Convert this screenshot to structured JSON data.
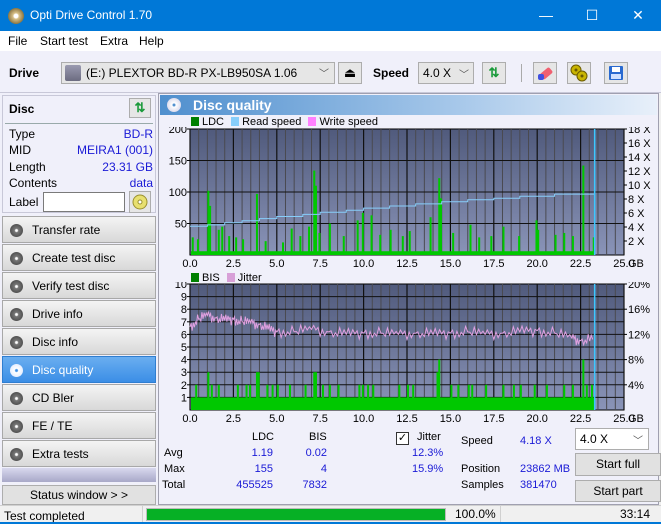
{
  "window": {
    "title": "Opti Drive Control 1.70",
    "minimize": "—",
    "maximize": "☐",
    "close": "✕"
  },
  "menu": [
    "File",
    "Start test",
    "Extra",
    "Help"
  ],
  "toolbar": {
    "drive_label": "Drive",
    "drive_value": "(E:)  PLEXTOR BD-R  PX-LB950SA 1.06",
    "eject_icon": "⏏",
    "speed_label": "Speed",
    "speed_value": "4.0 X",
    "chevron": "﹀",
    "refresh_icon": "⇅",
    "erase_icon": "eraser",
    "settings_icon": "gears",
    "save_icon": "floppy"
  },
  "disc": {
    "header": "Disc",
    "fields": [
      {
        "key": "Type",
        "value": "BD-R"
      },
      {
        "key": "MID",
        "value": "MEIRA1 (001)"
      },
      {
        "key": "Length",
        "value": "23.31 GB"
      },
      {
        "key": "Contents",
        "value": "data"
      }
    ],
    "label_key": "Label",
    "label_value": ""
  },
  "nav": [
    {
      "label": "Transfer rate",
      "active": false
    },
    {
      "label": "Create test disc",
      "active": false
    },
    {
      "label": "Verify test disc",
      "active": false
    },
    {
      "label": "Drive info",
      "active": false
    },
    {
      "label": "Disc info",
      "active": false
    },
    {
      "label": "Disc quality",
      "active": true
    },
    {
      "label": "CD Bler",
      "active": false
    },
    {
      "label": "FE / TE",
      "active": false
    },
    {
      "label": "Extra tests",
      "active": false
    }
  ],
  "status_window_button": "Status window > >",
  "main": {
    "title": "Disc quality",
    "legend_top": [
      {
        "label": "LDC",
        "color": "#008000"
      },
      {
        "label": "Read speed",
        "color": "#87cefa"
      },
      {
        "label": "Write speed",
        "color": "#ff80ff"
      }
    ],
    "legend_bottom": [
      {
        "label": "BIS",
        "color": "#008000"
      },
      {
        "label": "Jitter",
        "color": "#d8a0d8"
      }
    ]
  },
  "chart_data": [
    {
      "type": "bar",
      "title": "LDC / Read speed",
      "xlabel": "GB",
      "x_ticks": [
        "0.0",
        "2.5",
        "5.0",
        "7.5",
        "10.0",
        "12.5",
        "15.0",
        "17.5",
        "20.0",
        "22.5",
        "25.0"
      ],
      "xlim": [
        0,
        25
      ],
      "ylim_left": [
        0,
        200
      ],
      "y_ticks_left": [
        "200",
        "150",
        "100",
        "50"
      ],
      "ylim_right": [
        0,
        18
      ],
      "y_ticks_right": [
        "18 X",
        "16 X",
        "14 X",
        "12 X",
        "10 X",
        "8 X",
        "6 X",
        "4 X",
        "2 X"
      ],
      "end_marker_gb": 23.31,
      "ldc_peaks": [
        {
          "x": 0.1,
          "y": 28
        },
        {
          "x": 0.4,
          "y": 25
        },
        {
          "x": 1.0,
          "y": 102
        },
        {
          "x": 1.1,
          "y": 78
        },
        {
          "x": 1.6,
          "y": 40
        },
        {
          "x": 1.8,
          "y": 45
        },
        {
          "x": 2.2,
          "y": 30
        },
        {
          "x": 2.6,
          "y": 28
        },
        {
          "x": 3.0,
          "y": 25
        },
        {
          "x": 3.8,
          "y": 97
        },
        {
          "x": 4.3,
          "y": 22
        },
        {
          "x": 5.3,
          "y": 20
        },
        {
          "x": 5.8,
          "y": 42
        },
        {
          "x": 6.3,
          "y": 30
        },
        {
          "x": 6.8,
          "y": 45
        },
        {
          "x": 7.1,
          "y": 134
        },
        {
          "x": 7.2,
          "y": 110
        },
        {
          "x": 7.4,
          "y": 35
        },
        {
          "x": 8.0,
          "y": 50
        },
        {
          "x": 8.8,
          "y": 30
        },
        {
          "x": 9.6,
          "y": 55
        },
        {
          "x": 9.9,
          "y": 67
        },
        {
          "x": 10.4,
          "y": 63
        },
        {
          "x": 10.9,
          "y": 32
        },
        {
          "x": 11.5,
          "y": 40
        },
        {
          "x": 12.2,
          "y": 30
        },
        {
          "x": 12.6,
          "y": 38
        },
        {
          "x": 13.8,
          "y": 60
        },
        {
          "x": 14.3,
          "y": 122
        },
        {
          "x": 14.4,
          "y": 90
        },
        {
          "x": 15.1,
          "y": 35
        },
        {
          "x": 16.1,
          "y": 48
        },
        {
          "x": 16.6,
          "y": 28
        },
        {
          "x": 17.3,
          "y": 30
        },
        {
          "x": 18.0,
          "y": 45
        },
        {
          "x": 18.9,
          "y": 30
        },
        {
          "x": 19.9,
          "y": 55
        },
        {
          "x": 20.0,
          "y": 40
        },
        {
          "x": 21.0,
          "y": 32
        },
        {
          "x": 21.5,
          "y": 35
        },
        {
          "x": 22.0,
          "y": 30
        },
        {
          "x": 22.6,
          "y": 142
        },
        {
          "x": 23.2,
          "y": 28
        }
      ],
      "ldc_baseline": 6,
      "read_speed": [
        {
          "x": 0.0,
          "y": 4.1
        },
        {
          "x": 1.0,
          "y": 4.3
        },
        {
          "x": 2.0,
          "y": 4.6
        },
        {
          "x": 3.0,
          "y": 4.9
        },
        {
          "x": 4.0,
          "y": 5.2
        },
        {
          "x": 5.0,
          "y": 5.5
        },
        {
          "x": 6.5,
          "y": 5.8
        },
        {
          "x": 7.5,
          "y": 6.1
        },
        {
          "x": 9.0,
          "y": 6.4
        },
        {
          "x": 10.0,
          "y": 6.7
        },
        {
          "x": 11.5,
          "y": 7.0
        },
        {
          "x": 13.0,
          "y": 7.3
        },
        {
          "x": 14.5,
          "y": 7.6
        },
        {
          "x": 16.0,
          "y": 7.9
        },
        {
          "x": 17.5,
          "y": 8.1
        },
        {
          "x": 19.0,
          "y": 8.4
        },
        {
          "x": 21.0,
          "y": 8.7
        },
        {
          "x": 23.3,
          "y": 9.0
        }
      ]
    },
    {
      "type": "bar",
      "title": "BIS / Jitter",
      "xlabel": "GB",
      "x_ticks": [
        "0.0",
        "2.5",
        "5.0",
        "7.5",
        "10.0",
        "12.5",
        "15.0",
        "17.5",
        "20.0",
        "22.5",
        "25.0"
      ],
      "xlim": [
        0,
        25
      ],
      "ylim_left": [
        0,
        10
      ],
      "y_ticks_left": [
        "10",
        "9",
        "8",
        "7",
        "6",
        "5",
        "4",
        "3",
        "2",
        "1"
      ],
      "ylim_right": [
        0,
        20
      ],
      "y_ticks_right": [
        "20%",
        "16%",
        "12%",
        "8%",
        "4%"
      ],
      "end_marker_gb": 23.31,
      "bis_baseline": 1,
      "bis_peaks": [
        {
          "x": 0.3,
          "y": 2
        },
        {
          "x": 1.0,
          "y": 3
        },
        {
          "x": 1.2,
          "y": 2
        },
        {
          "x": 1.6,
          "y": 2
        },
        {
          "x": 2.7,
          "y": 2
        },
        {
          "x": 3.2,
          "y": 2
        },
        {
          "x": 3.4,
          "y": 2
        },
        {
          "x": 3.8,
          "y": 3
        },
        {
          "x": 3.9,
          "y": 3
        },
        {
          "x": 4.4,
          "y": 2
        },
        {
          "x": 4.7,
          "y": 2
        },
        {
          "x": 5.0,
          "y": 2
        },
        {
          "x": 5.7,
          "y": 2
        },
        {
          "x": 6.6,
          "y": 2
        },
        {
          "x": 7.1,
          "y": 3
        },
        {
          "x": 7.2,
          "y": 3
        },
        {
          "x": 7.6,
          "y": 2
        },
        {
          "x": 8.0,
          "y": 2
        },
        {
          "x": 8.5,
          "y": 2
        },
        {
          "x": 9.7,
          "y": 2
        },
        {
          "x": 9.9,
          "y": 2
        },
        {
          "x": 10.2,
          "y": 2
        },
        {
          "x": 10.5,
          "y": 2
        },
        {
          "x": 12.0,
          "y": 2
        },
        {
          "x": 12.5,
          "y": 2
        },
        {
          "x": 12.8,
          "y": 2
        },
        {
          "x": 14.2,
          "y": 3
        },
        {
          "x": 14.3,
          "y": 4
        },
        {
          "x": 15.0,
          "y": 2
        },
        {
          "x": 15.4,
          "y": 2
        },
        {
          "x": 16.0,
          "y": 2
        },
        {
          "x": 16.2,
          "y": 2
        },
        {
          "x": 17.0,
          "y": 2
        },
        {
          "x": 18.0,
          "y": 2
        },
        {
          "x": 18.6,
          "y": 2
        },
        {
          "x": 19.0,
          "y": 2
        },
        {
          "x": 19.8,
          "y": 2
        },
        {
          "x": 20.5,
          "y": 2
        },
        {
          "x": 21.5,
          "y": 2
        },
        {
          "x": 22.0,
          "y": 2
        },
        {
          "x": 22.6,
          "y": 4
        },
        {
          "x": 22.8,
          "y": 2
        },
        {
          "x": 23.1,
          "y": 2
        }
      ],
      "jitter_percent": [
        {
          "x": 0.0,
          "y": 13.2
        },
        {
          "x": 0.5,
          "y": 14.4
        },
        {
          "x": 1.0,
          "y": 15.0
        },
        {
          "x": 1.5,
          "y": 14.6
        },
        {
          "x": 2.0,
          "y": 14.2
        },
        {
          "x": 2.5,
          "y": 14.4
        },
        {
          "x": 3.0,
          "y": 14.0
        },
        {
          "x": 3.5,
          "y": 13.8
        },
        {
          "x": 4.0,
          "y": 13.6
        },
        {
          "x": 4.5,
          "y": 12.8
        },
        {
          "x": 5.0,
          "y": 12.4
        },
        {
          "x": 6.0,
          "y": 12.4
        },
        {
          "x": 7.0,
          "y": 12.8
        },
        {
          "x": 8.0,
          "y": 12.4
        },
        {
          "x": 9.0,
          "y": 12.0
        },
        {
          "x": 10.0,
          "y": 12.2
        },
        {
          "x": 11.0,
          "y": 12.2
        },
        {
          "x": 12.0,
          "y": 12.0
        },
        {
          "x": 13.0,
          "y": 12.2
        },
        {
          "x": 14.0,
          "y": 12.0
        },
        {
          "x": 15.0,
          "y": 12.2
        },
        {
          "x": 16.0,
          "y": 12.4
        },
        {
          "x": 17.0,
          "y": 12.0
        },
        {
          "x": 18.0,
          "y": 12.2
        },
        {
          "x": 19.0,
          "y": 12.4
        },
        {
          "x": 20.0,
          "y": 12.6
        },
        {
          "x": 21.0,
          "y": 12.2
        },
        {
          "x": 22.0,
          "y": 11.4
        },
        {
          "x": 22.5,
          "y": 11.0
        },
        {
          "x": 23.2,
          "y": 11.2
        }
      ]
    }
  ],
  "stats": {
    "col_ldc": "LDC",
    "col_bis": "BIS",
    "jitter_label": "Jitter",
    "jitter_checked": true,
    "rows": [
      {
        "label": "Avg",
        "ldc": "1.19",
        "bis": "0.02",
        "jitter": "12.3%"
      },
      {
        "label": "Max",
        "ldc": "155",
        "bis": "4",
        "jitter": "15.9%"
      },
      {
        "label": "Total",
        "ldc": "455525",
        "bis": "7832"
      }
    ],
    "speed_label": "Speed",
    "speed_value": "4.18 X",
    "position_label": "Position",
    "position_value": "23862 MB",
    "samples_label": "Samples",
    "samples_value": "381470",
    "speed_select": "4.0 X",
    "start_full": "Start full",
    "start_part": "Start part"
  },
  "statusbar": {
    "text": "Test completed",
    "progress": 100.0,
    "progress_text": "100.0%",
    "elapsed": "33:14"
  }
}
